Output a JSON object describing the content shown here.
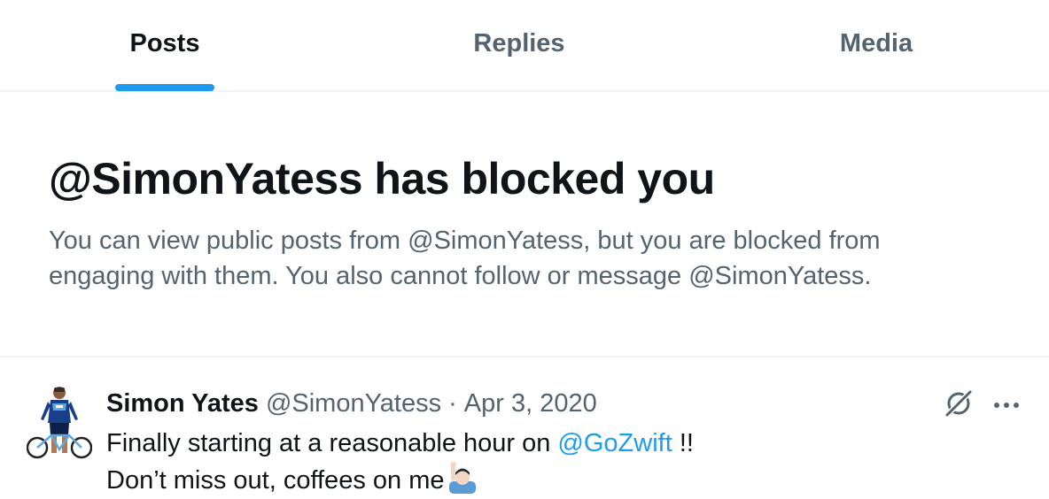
{
  "tabs": [
    {
      "label": "Posts",
      "active": true
    },
    {
      "label": "Replies",
      "active": false
    },
    {
      "label": "Media",
      "active": false
    }
  ],
  "blocked": {
    "title": "@SimonYatess has blocked you",
    "description": "You can view public posts from @SimonYatess, but you are blocked from engaging with them. You also cannot follow or message @SimonYatess."
  },
  "tweet": {
    "author_name": "Simon Yates",
    "author_handle": "@SimonYatess",
    "separator": "·",
    "date": "Apr 3, 2020",
    "line1_before": "Finally starting at a reasonable hour on ",
    "line1_mention": "@GoZwift",
    "line1_after": " !!",
    "line2": "Don’t miss out, coffees on me",
    "emoji": "raising-hand-emoji"
  },
  "icons": {
    "grok": "grok-icon",
    "more": "more-icon",
    "avatar": "avatar"
  },
  "colors": {
    "accent": "#1d9bf0",
    "text_primary": "#0f1419",
    "text_secondary": "#536471",
    "divider": "#eff3f4"
  }
}
